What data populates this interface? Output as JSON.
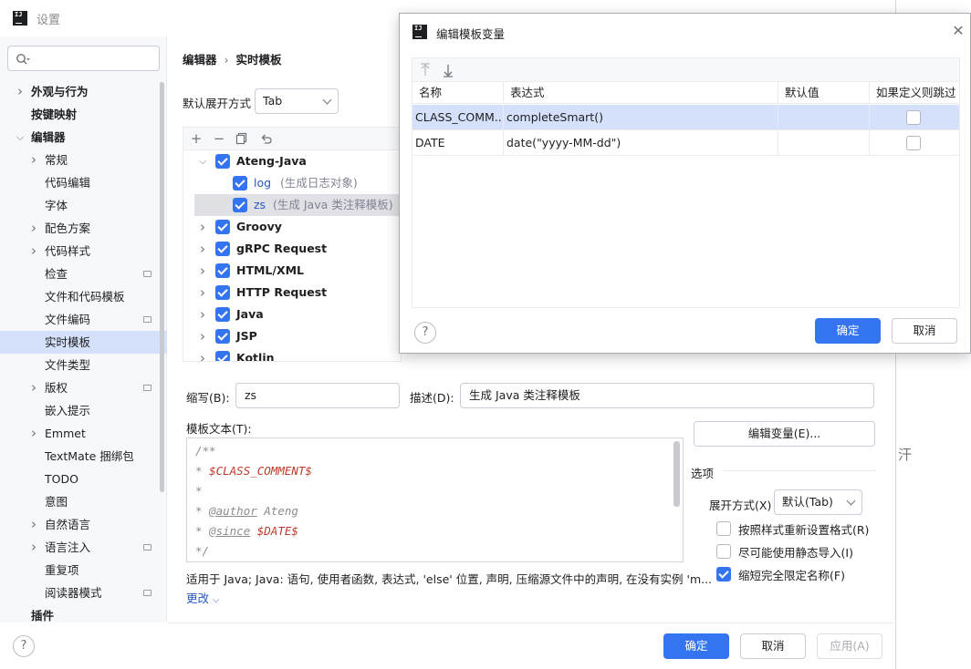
{
  "window": {
    "title": "设置"
  },
  "sidebar": {
    "items": [
      {
        "label": "外观与行为",
        "level": 0,
        "expandable": true,
        "expanded": false,
        "bold": true
      },
      {
        "label": "按键映射",
        "level": 0,
        "expandable": false,
        "bold": true
      },
      {
        "label": "编辑器",
        "level": 0,
        "expandable": true,
        "expanded": true,
        "bold": true
      },
      {
        "label": "常规",
        "level": 1,
        "expandable": true,
        "expanded": false
      },
      {
        "label": "代码编辑",
        "level": 1,
        "expandable": false
      },
      {
        "label": "字体",
        "level": 1,
        "expandable": false
      },
      {
        "label": "配色方案",
        "level": 1,
        "expandable": true,
        "expanded": false
      },
      {
        "label": "代码样式",
        "level": 1,
        "expandable": true,
        "expanded": false
      },
      {
        "label": "检查",
        "level": 1,
        "expandable": false,
        "project_icon": true
      },
      {
        "label": "文件和代码模板",
        "level": 1,
        "expandable": false
      },
      {
        "label": "文件编码",
        "level": 1,
        "expandable": false,
        "project_icon": true
      },
      {
        "label": "实时模板",
        "level": 1,
        "expandable": false,
        "selected": true
      },
      {
        "label": "文件类型",
        "level": 1,
        "expandable": false
      },
      {
        "label": "版权",
        "level": 1,
        "expandable": true,
        "expanded": false,
        "project_icon": true
      },
      {
        "label": "嵌入提示",
        "level": 1,
        "expandable": false
      },
      {
        "label": "Emmet",
        "level": 1,
        "expandable": true,
        "expanded": false
      },
      {
        "label": "TextMate 捆绑包",
        "level": 1,
        "expandable": false
      },
      {
        "label": "TODO",
        "level": 1,
        "expandable": false
      },
      {
        "label": "意图",
        "level": 1,
        "expandable": false
      },
      {
        "label": "自然语言",
        "level": 1,
        "expandable": true,
        "expanded": false
      },
      {
        "label": "语言注入",
        "level": 1,
        "expandable": true,
        "expanded": false,
        "project_icon": true
      },
      {
        "label": "重复项",
        "level": 1,
        "expandable": false
      },
      {
        "label": "阅读器模式",
        "level": 1,
        "expandable": false,
        "project_icon": true
      },
      {
        "label": "插件",
        "level": 0,
        "expandable": false,
        "bold": true
      }
    ]
  },
  "content": {
    "breadcrumb": [
      "编辑器",
      "实时模板"
    ],
    "expand_label": "默认展开方式",
    "expand_value": "Tab",
    "templates": [
      {
        "name": "Ateng-Java",
        "desc": "",
        "group": true,
        "expanded": true,
        "checked": true
      },
      {
        "name": "log",
        "desc": "(生成日志对象)",
        "group": false,
        "checked": true
      },
      {
        "name": "zs",
        "desc": "(生成 Java 类注释模板)",
        "group": false,
        "checked": true,
        "selected": true
      },
      {
        "name": "Groovy",
        "desc": "",
        "group": true,
        "expanded": false,
        "checked": true
      },
      {
        "name": "gRPC Request",
        "desc": "",
        "group": true,
        "expanded": false,
        "checked": true
      },
      {
        "name": "HTML/XML",
        "desc": "",
        "group": true,
        "expanded": false,
        "checked": true
      },
      {
        "name": "HTTP Request",
        "desc": "",
        "group": true,
        "expanded": false,
        "checked": true
      },
      {
        "name": "Java",
        "desc": "",
        "group": true,
        "expanded": false,
        "checked": true
      },
      {
        "name": "JSP",
        "desc": "",
        "group": true,
        "expanded": false,
        "checked": true
      },
      {
        "name": "Kotlin",
        "desc": "",
        "group": true,
        "expanded": false,
        "checked": true
      }
    ],
    "abbrev_label": "缩写(B):",
    "abbrev_value": "zs",
    "desc_label": "描述(D):",
    "desc_value": "生成 Java 类注释模板",
    "template_text_label": "模板文本(T):",
    "edit_vars_button": "编辑变量(E)...",
    "code_lines": [
      [
        {
          "t": "/**",
          "k": "c"
        }
      ],
      [
        {
          "t": "* ",
          "k": "c"
        },
        {
          "t": "$CLASS_COMMENT$",
          "k": "v"
        }
      ],
      [
        {
          "t": "*",
          "k": "c"
        }
      ],
      [
        {
          "t": "* ",
          "k": "c"
        },
        {
          "t": "@author",
          "k": "tag"
        },
        {
          "t": " Ateng",
          "k": "c"
        }
      ],
      [
        {
          "t": "* ",
          "k": "c"
        },
        {
          "t": "@since",
          "k": "tag"
        },
        {
          "t": " ",
          "k": "c"
        },
        {
          "t": "$DATE$",
          "k": "v"
        }
      ],
      [
        {
          "t": "*/",
          "k": "c"
        }
      ]
    ],
    "options_label": "选项",
    "expand_with_label": "展开方式(X)",
    "expand_with_value": "默认(Tab)",
    "options": [
      {
        "label": "按照样式重新设置格式(R)",
        "checked": false
      },
      {
        "label": "尽可能使用静态导入(I)",
        "checked": false
      },
      {
        "label": "缩短完全限定名称(F)",
        "checked": true
      }
    ],
    "applies_to": "适用于 Java; Java: 语句, 使用者函数, 表达式, 'else' 位置, 声明, 压缩源文件中的声明, 在没有实例 'm...",
    "more_link": "更改",
    "clipped_text": "汗"
  },
  "footer": {
    "ok": "确定",
    "cancel": "取消",
    "apply": "应用(A)"
  },
  "dialog": {
    "title": "编辑模板变量",
    "columns": [
      "名称",
      "表达式",
      "默认值",
      "如果定义则跳过"
    ],
    "rows": [
      {
        "name": "CLASS_COMM...",
        "expression": "completeSmart()",
        "default": "",
        "skip": false,
        "selected": true
      },
      {
        "name": "DATE",
        "expression": "date(\"yyyy-MM-dd\")",
        "default": "",
        "skip": false
      }
    ],
    "ok": "确定",
    "cancel": "取消"
  },
  "colors": {
    "accent": "#3574f0",
    "selection": "#d5e1fa",
    "sidebar_bg": "#f7f8fa",
    "variable": "#c0392b"
  }
}
